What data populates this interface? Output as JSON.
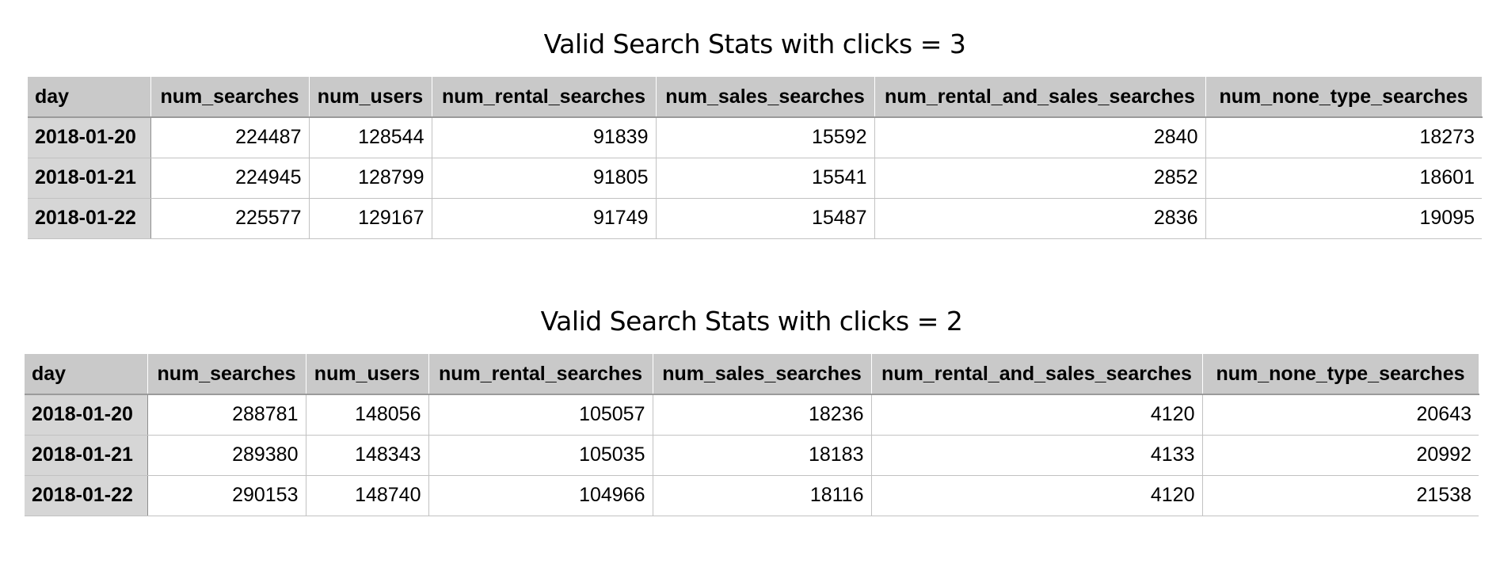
{
  "tables": [
    {
      "title": "Valid Search Stats with clicks = 3",
      "columns": [
        "day",
        "num_searches",
        "num_users",
        "num_rental_searches",
        "num_sales_searches",
        "num_rental_and_sales_searches",
        "num_none_type_searches"
      ],
      "rows": [
        [
          "2018-01-20",
          "224487",
          "128544",
          "91839",
          "15592",
          "2840",
          "18273"
        ],
        [
          "2018-01-21",
          "224945",
          "128799",
          "91805",
          "15541",
          "2852",
          "18601"
        ],
        [
          "2018-01-22",
          "225577",
          "129167",
          "91749",
          "15487",
          "2836",
          "19095"
        ]
      ]
    },
    {
      "title": "Valid Search Stats with clicks = 2",
      "columns": [
        "day",
        "num_searches",
        "num_users",
        "num_rental_searches",
        "num_sales_searches",
        "num_rental_and_sales_searches",
        "num_none_type_searches"
      ],
      "rows": [
        [
          "2018-01-20",
          "288781",
          "148056",
          "105057",
          "18236",
          "4120",
          "20643"
        ],
        [
          "2018-01-21",
          "289380",
          "148343",
          "105035",
          "18183",
          "4133",
          "20992"
        ],
        [
          "2018-01-22",
          "290153",
          "148740",
          "104966",
          "18116",
          "4120",
          "21538"
        ]
      ]
    }
  ],
  "chart_data": [
    {
      "type": "table",
      "title": "Valid Search Stats with clicks = 3",
      "columns": [
        "day",
        "num_searches",
        "num_users",
        "num_rental_searches",
        "num_sales_searches",
        "num_rental_and_sales_searches",
        "num_none_type_searches"
      ],
      "rows": [
        [
          "2018-01-20",
          224487,
          128544,
          91839,
          15592,
          2840,
          18273
        ],
        [
          "2018-01-21",
          224945,
          128799,
          91805,
          15541,
          2852,
          18601
        ],
        [
          "2018-01-22",
          225577,
          129167,
          91749,
          15487,
          2836,
          19095
        ]
      ]
    },
    {
      "type": "table",
      "title": "Valid Search Stats with clicks = 2",
      "columns": [
        "day",
        "num_searches",
        "num_users",
        "num_rental_searches",
        "num_sales_searches",
        "num_rental_and_sales_searches",
        "num_none_type_searches"
      ],
      "rows": [
        [
          "2018-01-20",
          288781,
          148056,
          105057,
          18236,
          4120,
          20643
        ],
        [
          "2018-01-21",
          289380,
          148343,
          105035,
          18183,
          4133,
          20992
        ],
        [
          "2018-01-22",
          290153,
          148740,
          104966,
          18116,
          4120,
          21538
        ]
      ]
    }
  ]
}
